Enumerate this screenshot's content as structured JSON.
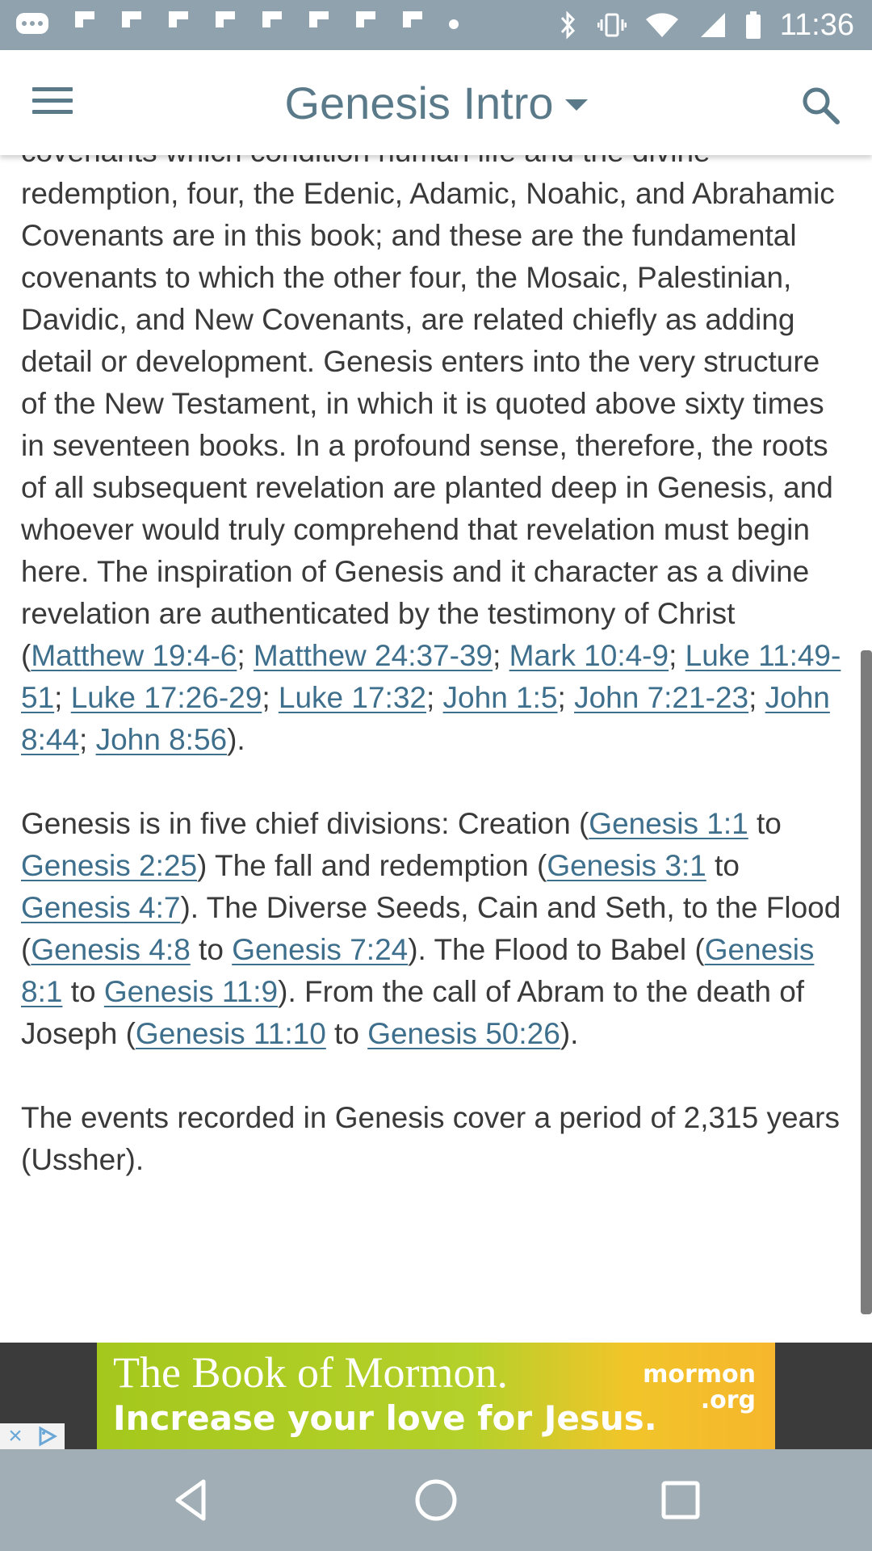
{
  "status_bar": {
    "time": "11:36",
    "left_icons": [
      "chat-icon",
      "flipboard-icon",
      "flipboard-icon",
      "flipboard-icon",
      "flipboard-icon",
      "flipboard-icon",
      "flipboard-icon",
      "flipboard-icon",
      "flipboard-icon",
      "dot-icon"
    ],
    "right_icons": [
      "bluetooth-icon",
      "vibrate-icon",
      "wifi-icon",
      "signal-icon",
      "battery-icon"
    ]
  },
  "app_bar": {
    "title": "Genesis Intro"
  },
  "content": {
    "top_partial": "covenants which condition human life and the divine",
    "p1": {
      "text": "redemption, four, the Edenic, Adamic, Noahic, and Abrahamic Covenants are in this book; and these are the fundamental covenants to which the other four, the Mosaic, Palestinian, Davidic, and New Covenants, are related chiefly as adding detail or development. Genesis enters into the very structure of the New Testament, in which it is quoted above sixty times in seventeen books. In a profound sense, therefore, the roots of all subsequent revelation are planted deep in Genesis, and whoever would truly comprehend that revelation must begin here. The inspiration of Genesis and it character as a divine revelation are authenticated by the testimony of Christ (",
      "refs": [
        "Matthew 19:4-6",
        "Matthew 24:37-39",
        "Mark 10:4-9",
        "Luke 11:49-51",
        "Luke 17:26-29",
        "Luke 17:32",
        "John 1:5",
        "John 7:21-23",
        "John 8:44",
        "John 8:56"
      ],
      "sep": "; ",
      "end": ")."
    },
    "p2": {
      "t0": "Genesis is in five chief divisions: Creation (",
      "r0": "Genesis 1:1",
      "t1": " to ",
      "r1": "Genesis 2:25",
      "t2": ") The fall and redemption (",
      "r2": "Genesis 3:1",
      "t3": " to ",
      "r3": "Genesis 4:7",
      "t4": "). The Diverse Seeds, Cain and Seth, to the Flood (",
      "r4": "Genesis 4:8",
      "t5": " to ",
      "r5": "Genesis 7:24",
      "t6": "). The Flood to Babel (",
      "r6": "Genesis 8:1",
      "t7": " to ",
      "r7": "Genesis 11:9",
      "t8": "). From the call of Abram to the death of Joseph (",
      "r8": "Genesis 11:10",
      "t9": " to ",
      "r9": "Genesis 50:26",
      "t10": ")."
    },
    "p3": "The events recorded in Genesis cover a period of 2,315 years (Ussher)."
  },
  "ad": {
    "line1": "The Book of Mormon.",
    "line2": "Increase your love for Jesus.",
    "logo_line1": "mormon",
    "logo_line2": ".org",
    "close_glyph": "×"
  },
  "colors": {
    "accent": "#5a7a8a",
    "link": "#3e6f8c",
    "status_bar": "#8fa2ad",
    "nav_bar": "#a1aeb5"
  }
}
